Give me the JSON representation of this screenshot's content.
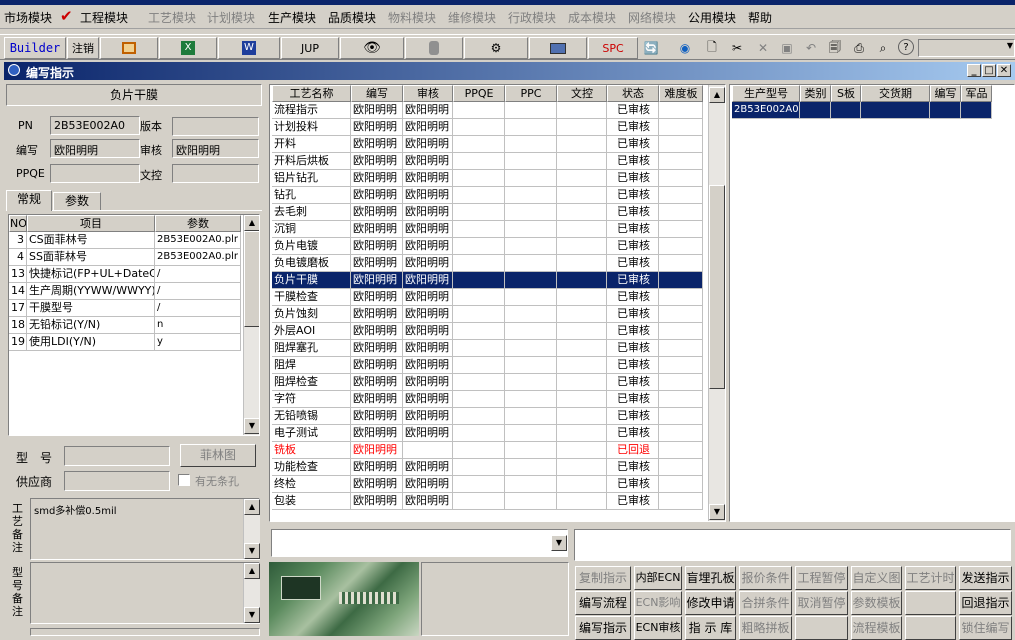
{
  "menubar": {
    "items": [
      {
        "label": "市场模块",
        "disabled": false
      },
      {
        "label": "工程模块",
        "disabled": false,
        "checked": true
      },
      {
        "label": "工艺模块",
        "disabled": true
      },
      {
        "label": "计划模块",
        "disabled": true
      },
      {
        "label": "生产模块",
        "disabled": false
      },
      {
        "label": "品质模块",
        "disabled": false
      },
      {
        "label": "物料模块",
        "disabled": true
      },
      {
        "label": "维修模块",
        "disabled": true
      },
      {
        "label": "行政模块",
        "disabled": true
      },
      {
        "label": "成本模块",
        "disabled": true
      },
      {
        "label": "网络模块",
        "disabled": true
      },
      {
        "label": "公用模块",
        "disabled": false
      },
      {
        "label": "帮助",
        "disabled": false
      }
    ]
  },
  "toolbar": {
    "builder": "Builder",
    "logout": "注销",
    "jup": "JUP",
    "spc": "SPC"
  },
  "window": {
    "title": "编写指示"
  },
  "left": {
    "process_name": "负片干膜",
    "pn_label": "PN",
    "pn_value": "2B53E002A0",
    "version_label": "版本",
    "version_value": "",
    "author_label": "编写",
    "author_value": "欧阳明明",
    "review_label": "审核",
    "review_value": "欧阳明明",
    "ppqe_label": "PPQE",
    "ppqe_value": "",
    "dc_label": "文控",
    "dc_value": "",
    "tabs": [
      "常规",
      "参数"
    ],
    "param_headers": [
      "NO",
      "项目",
      "参数"
    ],
    "params": [
      {
        "no": "3",
        "item": "CS面菲林号",
        "value": "2B53E002A0.plr"
      },
      {
        "no": "4",
        "item": "SS面菲林号",
        "value": "2B53E002A0.plr"
      },
      {
        "no": "13",
        "item": "快捷标记(FP+UL+DateC",
        "value": "/"
      },
      {
        "no": "14",
        "item": "生产周期(YYWW/WWYY)",
        "value": "/"
      },
      {
        "no": "17",
        "item": "干膜型号",
        "value": "/"
      },
      {
        "no": "18",
        "item": "无铅标记(Y/N)",
        "value": "n"
      },
      {
        "no": "19",
        "item": "使用LDI(Y/N)",
        "value": "y"
      }
    ],
    "model_label": "型　号",
    "model_value": "",
    "film_button": "菲林图",
    "supplier_label": "供应商",
    "supplier_value": "",
    "no_strip_label": "有无条孔",
    "process_note_label": "工艺备注",
    "process_note_value": "smd多补偿0.5mil",
    "model_note_label": "型号备注",
    "model_note_value": ""
  },
  "process_table": {
    "headers": [
      "工艺名称",
      "编写",
      "审核",
      "PPQE",
      "PPC",
      "文控",
      "状态",
      "难度板"
    ],
    "rows": [
      {
        "name": "流程指示",
        "author": "欧阳明明",
        "review": "欧阳明明",
        "status": "已审核"
      },
      {
        "name": "计划投料",
        "author": "欧阳明明",
        "review": "欧阳明明",
        "status": "已审核"
      },
      {
        "name": "开料",
        "author": "欧阳明明",
        "review": "欧阳明明",
        "status": "已审核"
      },
      {
        "name": "开料后烘板",
        "author": "欧阳明明",
        "review": "欧阳明明",
        "status": "已审核"
      },
      {
        "name": "铝片钻孔",
        "author": "欧阳明明",
        "review": "欧阳明明",
        "status": "已审核"
      },
      {
        "name": "钻孔",
        "author": "欧阳明明",
        "review": "欧阳明明",
        "status": "已审核"
      },
      {
        "name": "去毛刺",
        "author": "欧阳明明",
        "review": "欧阳明明",
        "status": "已审核"
      },
      {
        "name": "沉铜",
        "author": "欧阳明明",
        "review": "欧阳明明",
        "status": "已审核"
      },
      {
        "name": "负片电镀",
        "author": "欧阳明明",
        "review": "欧阳明明",
        "status": "已审核"
      },
      {
        "name": "负电镀磨板",
        "author": "欧阳明明",
        "review": "欧阳明明",
        "status": "已审核"
      },
      {
        "name": "负片干膜",
        "author": "欧阳明明",
        "review": "欧阳明明",
        "status": "已审核",
        "selected": true
      },
      {
        "name": "干膜检查",
        "author": "欧阳明明",
        "review": "欧阳明明",
        "status": "已审核"
      },
      {
        "name": "负片蚀刻",
        "author": "欧阳明明",
        "review": "欧阳明明",
        "status": "已审核"
      },
      {
        "name": "外层AOI",
        "author": "欧阳明明",
        "review": "欧阳明明",
        "status": "已审核"
      },
      {
        "name": "阻焊塞孔",
        "author": "欧阳明明",
        "review": "欧阳明明",
        "status": "已审核"
      },
      {
        "name": "阻焊",
        "author": "欧阳明明",
        "review": "欧阳明明",
        "status": "已审核"
      },
      {
        "name": "阻焊检查",
        "author": "欧阳明明",
        "review": "欧阳明明",
        "status": "已审核"
      },
      {
        "name": "字符",
        "author": "欧阳明明",
        "review": "欧阳明明",
        "status": "已审核"
      },
      {
        "name": "无铅喷锡",
        "author": "欧阳明明",
        "review": "欧阳明明",
        "status": "已审核"
      },
      {
        "name": "电子测试",
        "author": "欧阳明明",
        "review": "欧阳明明",
        "status": "已审核"
      },
      {
        "name": "铣板",
        "author": "欧阳明明",
        "review": "",
        "status": "已回退",
        "red": true
      },
      {
        "name": "功能检查",
        "author": "欧阳明明",
        "review": "欧阳明明",
        "status": "已审核"
      },
      {
        "name": "终检",
        "author": "欧阳明明",
        "review": "欧阳明明",
        "status": "已审核"
      },
      {
        "name": "包装",
        "author": "欧阳明明",
        "review": "欧阳明明",
        "status": "已审核"
      }
    ]
  },
  "right_table": {
    "headers": [
      "生产型号",
      "类别",
      "S板",
      "交货期",
      "编写",
      "军品"
    ],
    "rows": [
      {
        "model": "2B53E002A0",
        "type": "",
        "s": "",
        "due": "",
        "author": "",
        "mil": ""
      }
    ]
  },
  "bottom": {
    "combo1_value": "",
    "text2_value": "",
    "buttons": [
      [
        "复制指示",
        "内部ECN",
        "盲埋孔板",
        "报价条件",
        "工程暂停",
        "自定义图",
        "工艺计时",
        "发送指示"
      ],
      [
        "编写流程",
        "ECN影响",
        "修改申请",
        "合拼条件",
        "取消暂停",
        "参数模板",
        "",
        "回退指示"
      ],
      [
        "编写指示",
        "ECN审核",
        "指 示 库",
        "粗略拼板",
        "",
        "流程模板",
        "",
        "锁住编写"
      ]
    ],
    "disabled": [
      [
        true,
        false,
        false,
        true,
        true,
        true,
        true,
        false
      ],
      [
        false,
        true,
        false,
        true,
        true,
        true,
        true,
        false
      ],
      [
        false,
        false,
        false,
        true,
        true,
        true,
        true,
        true
      ]
    ]
  },
  "colors": {
    "title_bar": "#0a246a",
    "selection": "#0a246a",
    "reject_red": "#ff0000",
    "check_red": "#cc0000"
  }
}
